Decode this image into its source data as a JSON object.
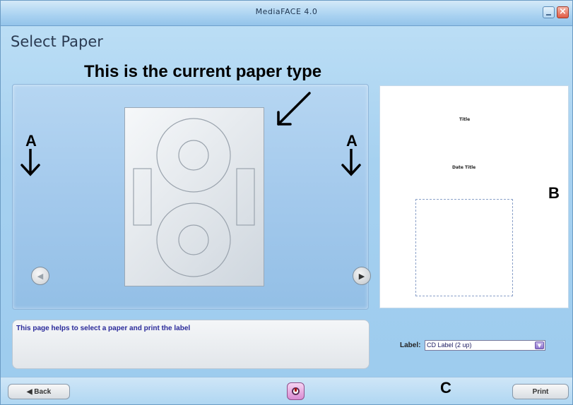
{
  "window": {
    "title": "MediaFACE 4.0",
    "close_glyph": "×"
  },
  "page": {
    "section_title": "Select Paper"
  },
  "annotations": {
    "title": "This is the current paper type",
    "a_left": "A",
    "a_right": "A",
    "b": "B",
    "c": "C"
  },
  "preview": {
    "title_text": "Title",
    "date_text": "Date Title"
  },
  "help": {
    "text": "This page helps to select a paper and print the label"
  },
  "label_selector": {
    "caption": "Label:",
    "value": "CD Label (2 up)"
  },
  "buttons": {
    "back": "◀ Back",
    "print": "Print",
    "prev_glyph": "◀",
    "next_glyph": "▶",
    "dropdown_glyph": "▼"
  },
  "icons": {
    "prev": "left-arrow-icon",
    "next": "right-arrow-icon",
    "center": "disc-icon",
    "minimize": "minimize-icon",
    "close": "close-icon"
  },
  "colors": {
    "background": "#a6d1f0",
    "help_text": "#2a2a9a",
    "annotation": "#000000"
  }
}
